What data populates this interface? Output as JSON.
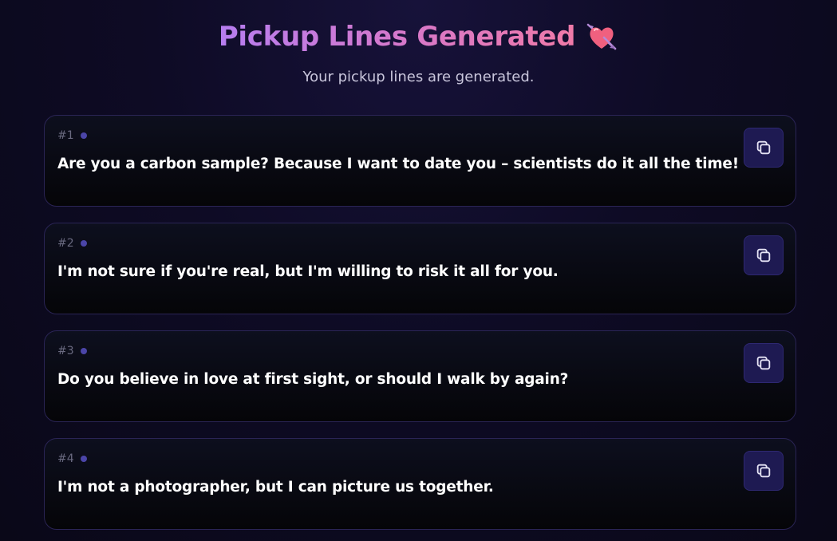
{
  "header": {
    "title": "Pickup Lines Generated",
    "title_emoji_icon": "heart-with-arrow-icon",
    "subtitle": "Your pickup lines are generated."
  },
  "lines": [
    {
      "number": "#1",
      "text": "Are you a carbon sample? Because I want to date you – scientists do it all the time!"
    },
    {
      "number": "#2",
      "text": "I'm not sure if you're real, but I'm willing to risk it all for you."
    },
    {
      "number": "#3",
      "text": "Do you believe in love at first sight, or should I walk by again?"
    },
    {
      "number": "#4",
      "text": "I'm not a photographer, but I can picture us together."
    }
  ],
  "icons": {
    "copy": "copy-icon"
  },
  "colors": {
    "background": "#0e0b25",
    "title_gradient_start": "#b67df0",
    "title_gradient_end": "#f07aa8",
    "card_border": "#2a2455",
    "copy_button_bg": "#1e1a52",
    "dot": "#4b45a8"
  }
}
